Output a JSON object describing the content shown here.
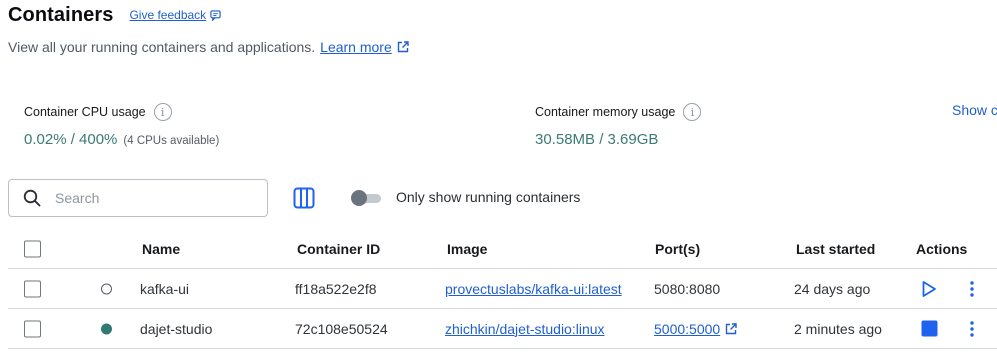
{
  "header": {
    "title": "Containers",
    "feedback_label": "Give feedback",
    "subtitle": "View all your running containers and applications.",
    "learn_more_label": "Learn more"
  },
  "stats": {
    "cpu": {
      "label": "Container CPU usage",
      "value": "0.02% / 400%",
      "note": "(4 CPUs available)"
    },
    "memory": {
      "label": "Container memory usage",
      "value": "30.58MB / 3.69GB"
    },
    "show_charts_label": "Show c"
  },
  "toolbar": {
    "search_placeholder": "Search",
    "toggle_label": "Only show running containers",
    "toggle_on": false
  },
  "table": {
    "columns": {
      "name": "Name",
      "container_id": "Container ID",
      "image": "Image",
      "ports": "Port(s)",
      "last_started": "Last started",
      "actions": "Actions"
    },
    "rows": [
      {
        "name": "kafka-ui",
        "container_id": "ff18a522e2f8",
        "image": "provectuslabs/kafka-ui:latest",
        "ports": "5080:8080",
        "last_started": "24 days ago",
        "status": "stopped"
      },
      {
        "name": "dajet-studio",
        "container_id": "72c108e50524",
        "image": "zhichkin/dajet-studio:linux",
        "ports": "5000:5000",
        "last_started": "2 minutes ago",
        "status": "running"
      }
    ]
  },
  "colors": {
    "accent": "#1f5fcf",
    "running": "#2f7a72",
    "stop": "#1d63ed"
  },
  "icons": {
    "feedback": "chat-bubble-icon",
    "external": "external-link-icon",
    "info": "info-icon",
    "search": "search-icon",
    "columns": "columns-icon",
    "start": "play-icon",
    "stop": "stop-icon",
    "more": "more-vertical-icon"
  }
}
